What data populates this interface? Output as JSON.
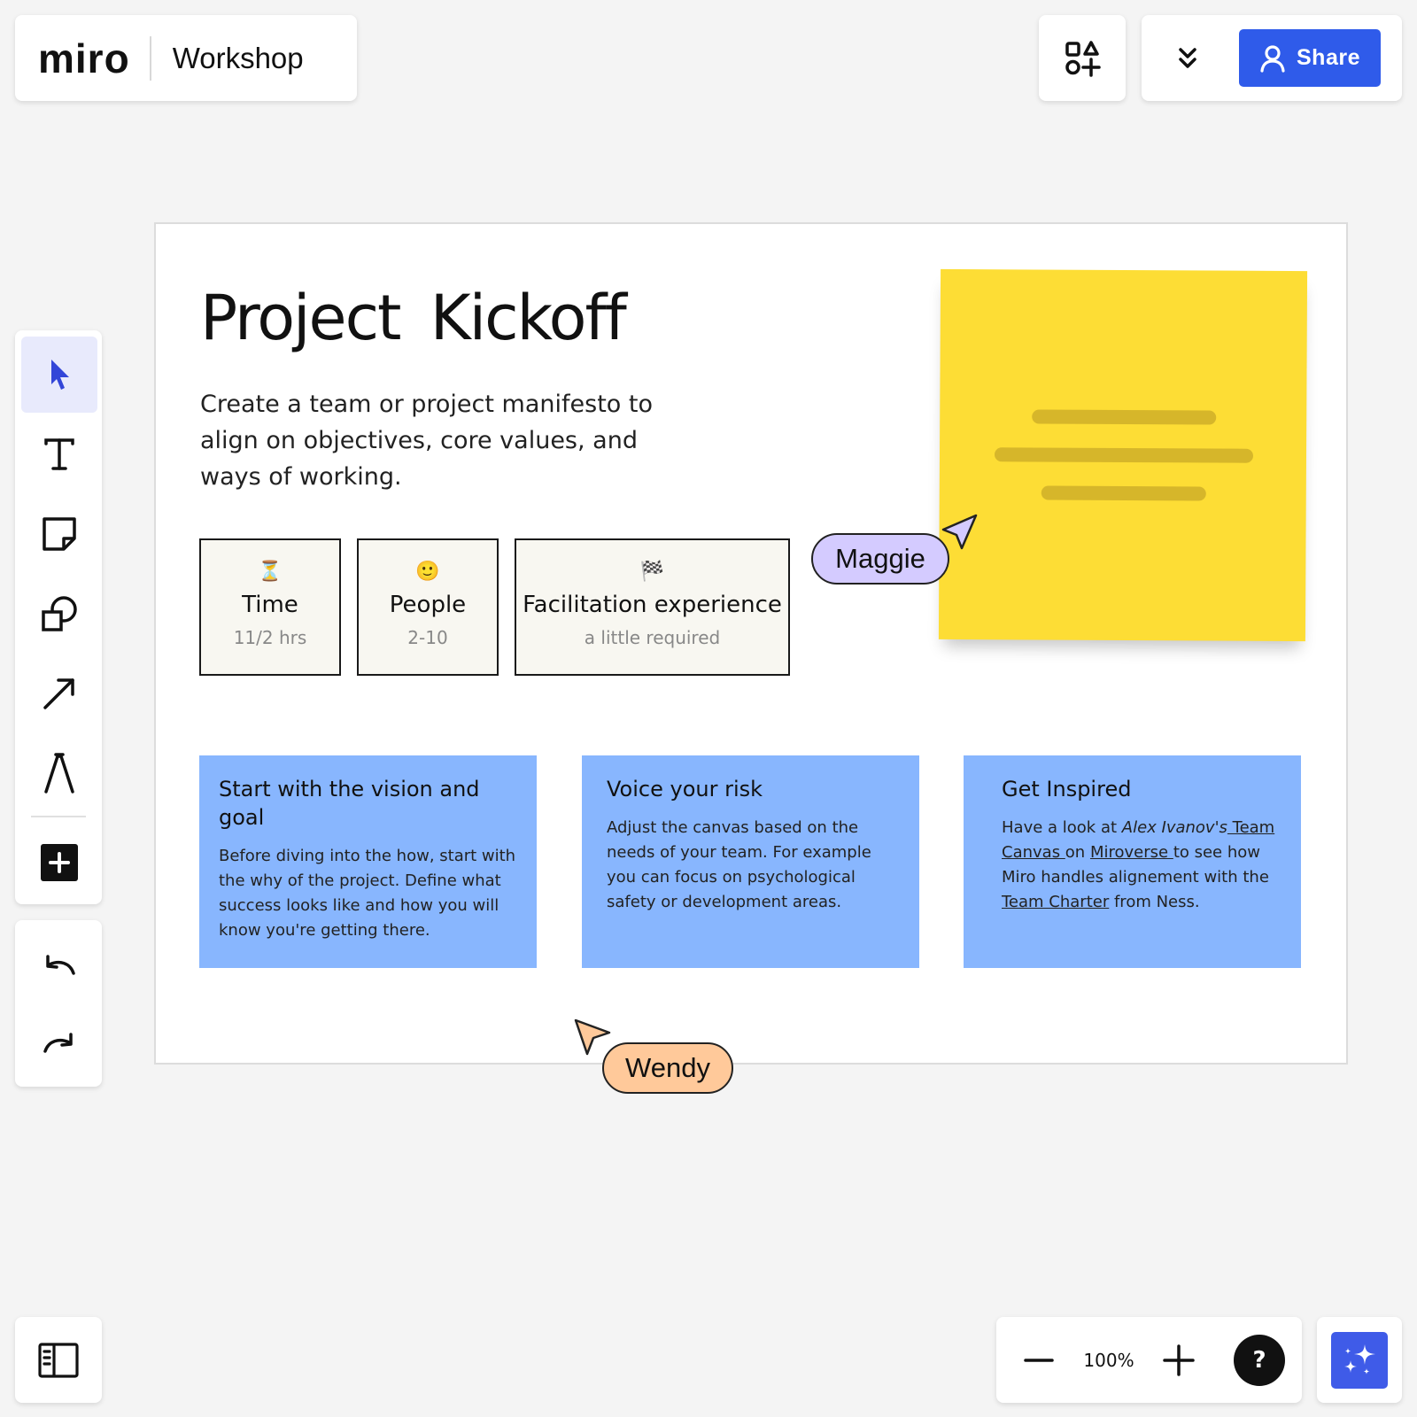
{
  "header": {
    "logo": "miro",
    "board_name": "Workshop",
    "share_label": "Share"
  },
  "toolbar": {
    "tools": [
      "select",
      "text",
      "sticky-note",
      "shapes",
      "arrow",
      "pen",
      "add"
    ],
    "active_tool": "select"
  },
  "frame": {
    "title": "Project  Kickoff",
    "subtitle": "Create a team or project manifesto to align on objectives, core values, and ways of working.",
    "info_cards": [
      {
        "emoji": "⏳",
        "label": "Time",
        "value": "11/2 hrs"
      },
      {
        "emoji": "🙂",
        "label": "People",
        "value": "2-10"
      },
      {
        "emoji": "🏁",
        "label": "Facilitation experience",
        "value": "a little  required"
      }
    ],
    "cards": [
      {
        "title": "Start with the vision and goal",
        "body": "Before diving into the how, start with the why of the project. Define what success looks like and how you will know you're getting there."
      },
      {
        "title": "Voice your risk",
        "body": "Adjust the canvas based on the needs of your team. For example  you can focus on psychological safety or development areas."
      },
      {
        "title": "Get Inspired",
        "body_parts": {
          "p1": "Have a look at ",
          "author": "Alex Ivanov's",
          "link1": " Team Canvas ",
          "p2": "on ",
          "link2": "Miroverse ",
          "p3": " to see how Miro handles alignement with the ",
          "link3": "Team Charter",
          "p4": " from Ness."
        }
      }
    ]
  },
  "collaborators": [
    {
      "name": "Maggie",
      "color": "#d4cbff"
    },
    {
      "name": "Wendy",
      "color": "#ffc99a"
    }
  ],
  "zoom": {
    "level": "100%"
  },
  "help_label": "?",
  "colors": {
    "accent": "#2f5bea",
    "sticky_yellow": "#fddd35",
    "card_blue": "#88b6fe",
    "canvas": "#f4f4f4"
  }
}
